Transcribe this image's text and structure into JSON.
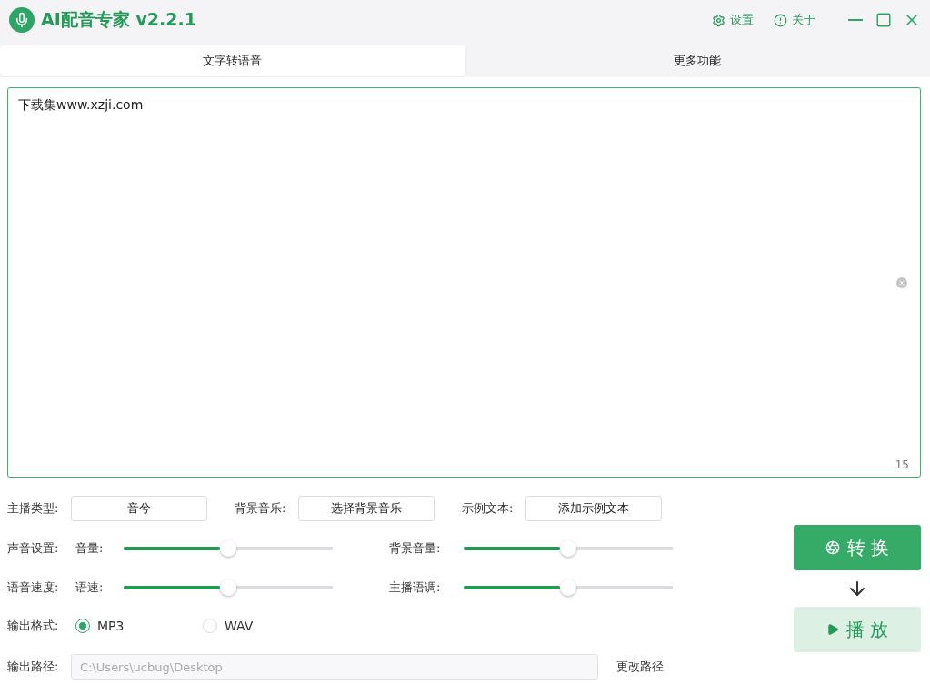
{
  "window": {
    "title": "AI配音专家 v2.2.1",
    "actions": [
      {
        "kind": "settings",
        "label": "设置"
      },
      {
        "kind": "about",
        "label": "关于"
      }
    ]
  },
  "tabs": [
    {
      "label": "文字转语音",
      "selected": true
    },
    {
      "label": "更多功能",
      "selected": false
    }
  ],
  "editor": {
    "value": "下载集www.xzji.com",
    "count": "15"
  },
  "pickers": [
    {
      "label": "主播类型:",
      "button": "音兮"
    },
    {
      "label": "背景音乐:",
      "button": "选择背景音乐"
    },
    {
      "label": "示例文本:",
      "button": "添加示例文本"
    }
  ],
  "sliders": [
    {
      "group": "声音设置:",
      "label": "音量:",
      "level": 0.5
    },
    {
      "label": "背景音量:",
      "level": 0.5
    },
    {
      "group": "语音速度:",
      "label": "语速:",
      "level": 0.5
    },
    {
      "label": "主播语调:",
      "level": 0.5
    }
  ],
  "format": {
    "label": "输出格式:",
    "options": [
      {
        "label": "MP3",
        "selected": true
      },
      {
        "label": "WAV",
        "selected": false
      }
    ]
  },
  "output": {
    "label": "输出路径:",
    "value": "C:\\Users\\ucbug\\Desktop",
    "change": "更改路径"
  },
  "convert": "转 换",
  "play": "播 放"
}
